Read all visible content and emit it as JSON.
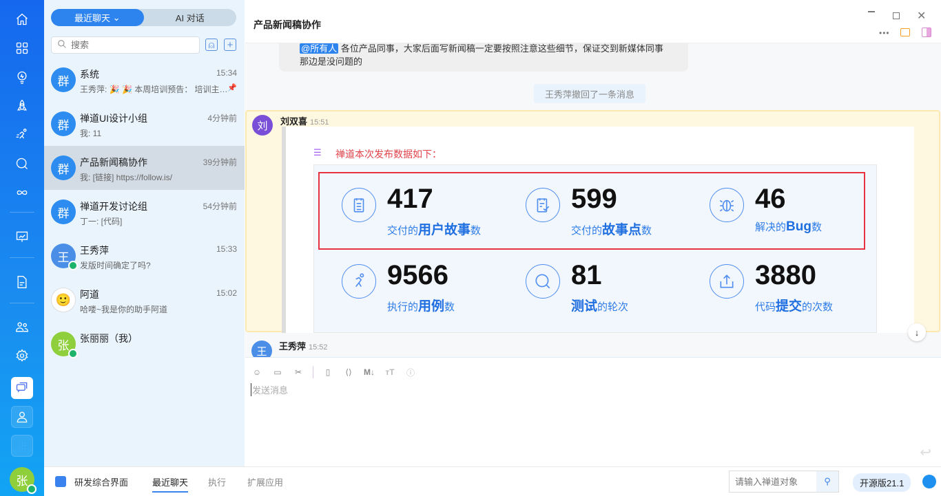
{
  "rail": {
    "items": [
      "home-icon",
      "grid-icon",
      "bulb-icon",
      "rocket-icon",
      "runner-icon",
      "search-circle-icon",
      "infinity-icon",
      "board-icon",
      "document-icon",
      "users-icon",
      "gear-icon",
      "chat-icon",
      "user-icon",
      "apps-icon"
    ],
    "user_avatar": "张"
  },
  "list": {
    "tabs": [
      "最近聊天",
      "AI 对话"
    ],
    "search_placeholder": "搜索",
    "items": [
      {
        "avatar": "群",
        "name": "系统",
        "time": "15:34",
        "preview": "王秀萍: 🎉 🎉 本周培训预告： 培训主…",
        "color": "#2d8cf0"
      },
      {
        "avatar": "群",
        "name": "禅道UI设计小组",
        "time": "4分钟前",
        "preview": "我: 11",
        "color": "#2d8cf0"
      },
      {
        "avatar": "群",
        "name": "产品新闻稿协作",
        "time": "39分钟前",
        "preview": "我: [链接] https://follow.is/",
        "color": "#2d8cf0"
      },
      {
        "avatar": "群",
        "name": "禅道开发讨论组",
        "time": "54分钟前",
        "preview": "丁一: [代码]",
        "color": "#2d8cf0"
      },
      {
        "avatar": "王",
        "name": "王秀萍",
        "time": "15:33",
        "preview": "发版时间确定了吗?",
        "color": "#4b8ee8"
      },
      {
        "avatar": "",
        "name": "阿道",
        "time": "15:02",
        "preview": "哈喽~我是你的助手阿道",
        "color": "#ffffff"
      },
      {
        "avatar": "张",
        "name": "张丽丽（我）",
        "time": "",
        "preview": "",
        "color": "#8fcf3c"
      }
    ]
  },
  "chat": {
    "title": "产品新闻稿协作",
    "prev_message": {
      "mention": "@所有人",
      "text": " 各位产品同事，大家后面写新闻稿一定要按照注意这些细节，保证交到新媒体同事那边是没问题的"
    },
    "recall_notice": "王秀萍撤回了一条消息",
    "highlight_message": {
      "avatar": "刘",
      "sender": "刘双喜",
      "time": "15:51",
      "card_title": "禅道本次发布数据如下：",
      "stats": [
        {
          "icon": "story-icon",
          "value": "417",
          "pre": "交付的",
          "bold": "用户故事",
          "post": "数"
        },
        {
          "icon": "story-point-icon",
          "value": "599",
          "pre": "交付的",
          "bold": "故事点",
          "post": "数"
        },
        {
          "icon": "bug-icon",
          "value": "46",
          "pre": "解决的",
          "bold": "Bug",
          "post": "数"
        },
        {
          "icon": "run-case-icon",
          "value": "9566",
          "pre": "执行的",
          "bold": "用例",
          "post": "数"
        },
        {
          "icon": "test-round-icon",
          "value": "81",
          "pre": "",
          "bold": "测试",
          "post": "的轮次"
        },
        {
          "icon": "commit-icon",
          "value": "3880",
          "pre": "代码",
          "bold": "提交",
          "post": "的次数"
        }
      ]
    },
    "next_message": {
      "avatar": "王",
      "sender": "王秀萍",
      "time": "15:52"
    },
    "editor_placeholder": "发送消息",
    "tools": [
      "emoji-icon",
      "screenshot-icon",
      "cut-icon",
      "file-icon",
      "code-icon",
      "markdown-icon",
      "font-size-icon",
      "help-icon"
    ]
  },
  "bottom": {
    "app": "研发综合界面",
    "tabs": [
      "最近聊天",
      "执行",
      "扩展应用"
    ],
    "search_placeholder": "请输入禅道对象",
    "version": "开源版21.1"
  }
}
